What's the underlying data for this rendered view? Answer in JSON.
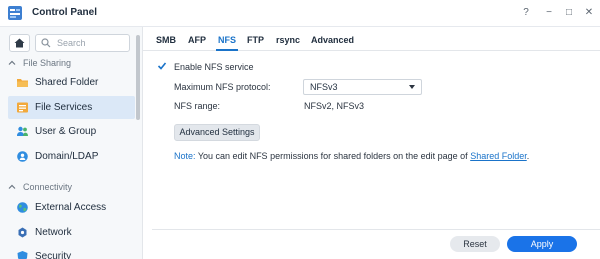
{
  "window": {
    "title": "Control Panel",
    "controls": {
      "help": "?",
      "minimize": "−",
      "maximize": "□",
      "close": "✕"
    }
  },
  "sidebar": {
    "search_placeholder": "Search",
    "sections": [
      {
        "label": "File Sharing"
      },
      {
        "label": "Connectivity"
      }
    ],
    "items": [
      {
        "label": "Shared Folder",
        "icon": "folder-icon"
      },
      {
        "label": "File Services",
        "icon": "file-services-icon",
        "active": true
      },
      {
        "label": "User & Group",
        "icon": "user-group-icon"
      },
      {
        "label": "Domain/LDAP",
        "icon": "domain-icon"
      },
      {
        "label": "External Access",
        "icon": "globe-icon"
      },
      {
        "label": "Network",
        "icon": "network-icon"
      },
      {
        "label": "Security",
        "icon": "shield-icon"
      }
    ]
  },
  "tabs": [
    {
      "label": "SMB"
    },
    {
      "label": "AFP"
    },
    {
      "label": "NFS",
      "active": true
    },
    {
      "label": "FTP"
    },
    {
      "label": "rsync"
    },
    {
      "label": "Advanced"
    }
  ],
  "nfs": {
    "enable_label": "Enable NFS service",
    "enable_checked": true,
    "max_protocol_label": "Maximum NFS protocol:",
    "max_protocol_value": "NFSv3",
    "range_label": "NFS range:",
    "range_value": "NFSv2, NFSv3",
    "advanced_button": "Advanced Settings",
    "note_label": "Note:",
    "note_text": " You can edit NFS permissions for shared folders on the edit page of ",
    "note_link": "Shared Folder",
    "note_end": "."
  },
  "footer": {
    "reset": "Reset",
    "apply": "Apply"
  },
  "colors": {
    "accent": "#1a73c9",
    "apply_bg": "#1a73e8",
    "active_item_bg": "#dbe8f7"
  }
}
